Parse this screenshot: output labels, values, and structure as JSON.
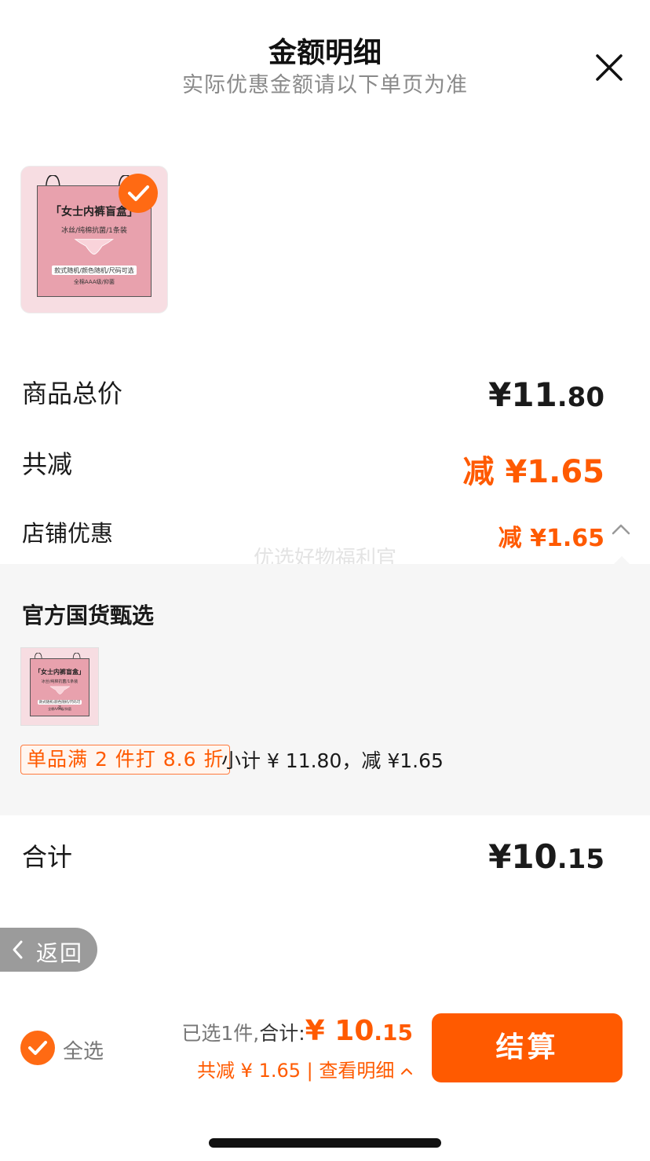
{
  "header": {
    "title": "金额明细",
    "subtitle": "实际优惠金额请以下单页为准"
  },
  "product": {
    "image_title": "「女士内裤盲盒」",
    "image_sub": "冰丝/纯棉抗菌/1条装",
    "image_band": "款式随机/颜色随机/尺码可选",
    "image_foot": "全棉AAA级/抑菌"
  },
  "summary": {
    "total_label": "商品总价",
    "total_currency": "¥",
    "total_int": "11",
    "total_dec": ".80",
    "reduce_label": "共减",
    "reduce_value": "减 ¥1.65",
    "shop_label": "店铺优惠",
    "shop_value": "减 ¥1.65"
  },
  "watermark": "优选好物福利官",
  "detail": {
    "store_name": "官方国货甄选",
    "promo_tag": "单品满 2 件打 8.6 折",
    "promo_text": "小计 ¥ 11.80，减 ¥1.65"
  },
  "sum": {
    "label": "合计",
    "currency": "¥",
    "int": "10",
    "dec": ".15"
  },
  "back": {
    "label": "返回"
  },
  "bottom_bar": {
    "select_all": "全选",
    "selected_count": "已选1件,",
    "total_label": "合计:",
    "total_currency": "¥",
    "total_int": "10",
    "total_dec": ".15",
    "reduce_text": "共减 ¥ 1.65 | 查看明细",
    "checkout": "结算"
  },
  "colors": {
    "accent": "#ff5a00",
    "check": "#ff6a13",
    "panel": "#f6f6f6"
  }
}
